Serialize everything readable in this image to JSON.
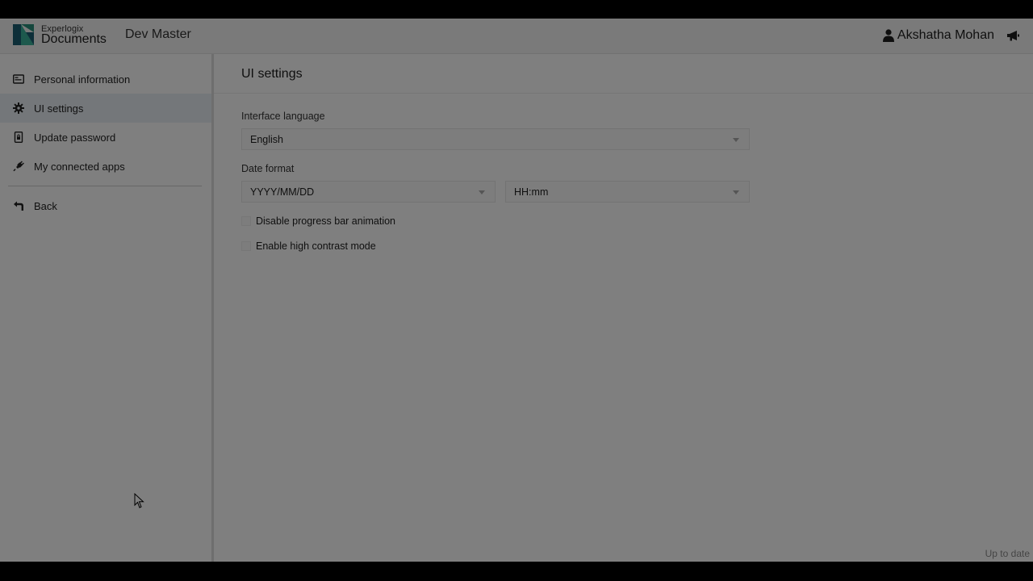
{
  "header": {
    "brand_small": "Experlogix",
    "brand_big": "Documents",
    "app_name": "Dev Master",
    "user_name": "Akshatha Mohan",
    "logo_colors": [
      "#2a8f7a",
      "#1b5f73",
      "#3bb39a"
    ],
    "icons": {
      "user": "user-icon",
      "announce": "megaphone-icon"
    }
  },
  "sidebar": {
    "items": [
      {
        "label": "Personal information",
        "icon": "id-card-icon",
        "active": false
      },
      {
        "label": "UI settings",
        "icon": "gear-icon",
        "active": true
      },
      {
        "label": "Update password",
        "icon": "lock-file-icon",
        "active": false
      },
      {
        "label": "My connected apps",
        "icon": "plug-icon",
        "active": false
      }
    ],
    "back": {
      "label": "Back",
      "icon": "back-arrow-icon"
    }
  },
  "main": {
    "title": "UI settings",
    "interface_language": {
      "label": "Interface language",
      "value": "English"
    },
    "date_format": {
      "label": "Date format",
      "date_value": "YYYY/MM/DD",
      "time_value": "HH:mm"
    },
    "checkboxes": [
      {
        "label": "Disable progress bar animation",
        "checked": false
      },
      {
        "label": "Enable high contrast mode",
        "checked": false
      }
    ],
    "status": "Up to date"
  },
  "colors": {
    "active_nav_bg": "#e9eff5",
    "accent": "#2a8f7a"
  }
}
